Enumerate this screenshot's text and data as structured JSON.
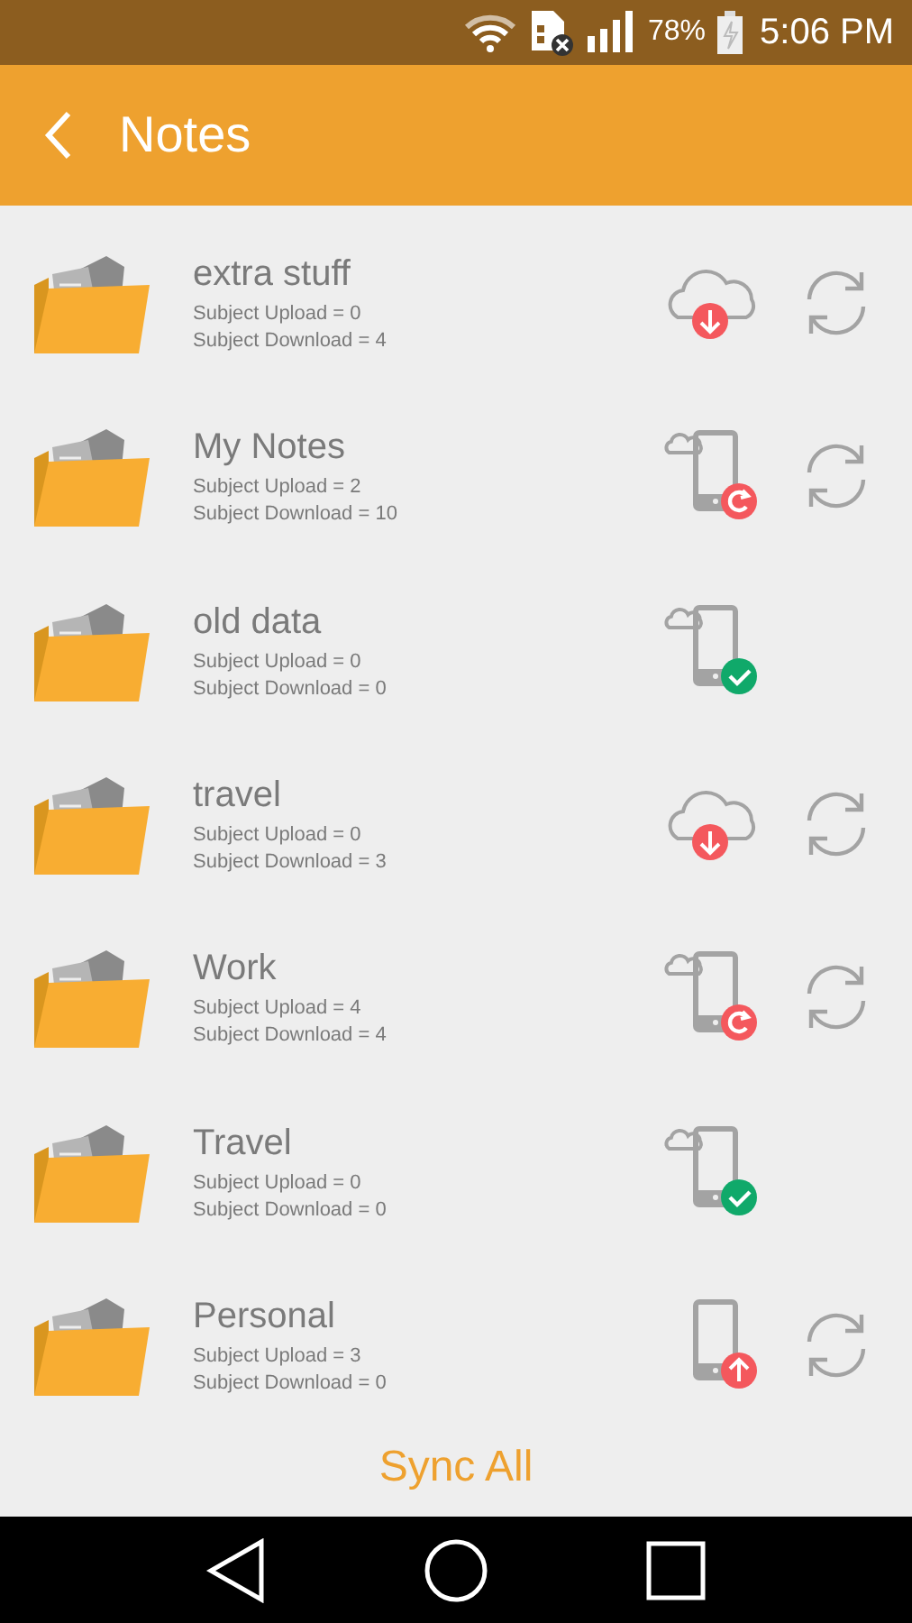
{
  "status_bar": {
    "battery": "78%",
    "time": "5:06 PM"
  },
  "header": {
    "title": "Notes"
  },
  "subjects": [
    {
      "name": "extra stuff",
      "upload": "Subject Upload = 0",
      "download": "Subject Download = 4",
      "kind": "download",
      "syncable": true
    },
    {
      "name": "My Notes",
      "upload": "Subject Upload = 2",
      "download": "Subject Download = 10",
      "kind": "conflict",
      "syncable": true
    },
    {
      "name": "old data",
      "upload": "Subject Upload = 0",
      "download": "Subject Download = 0",
      "kind": "synced",
      "syncable": false
    },
    {
      "name": "travel",
      "upload": "Subject Upload = 0",
      "download": "Subject Download = 3",
      "kind": "download",
      "syncable": true
    },
    {
      "name": "Work",
      "upload": "Subject Upload = 4",
      "download": "Subject Download = 4",
      "kind": "conflict",
      "syncable": true
    },
    {
      "name": "Travel",
      "upload": "Subject Upload = 0",
      "download": "Subject Download = 0",
      "kind": "synced",
      "syncable": false
    },
    {
      "name": "Personal",
      "upload": "Subject Upload = 3",
      "download": "Subject Download = 0",
      "kind": "upload",
      "syncable": true
    }
  ],
  "sync_all": "Sync All"
}
